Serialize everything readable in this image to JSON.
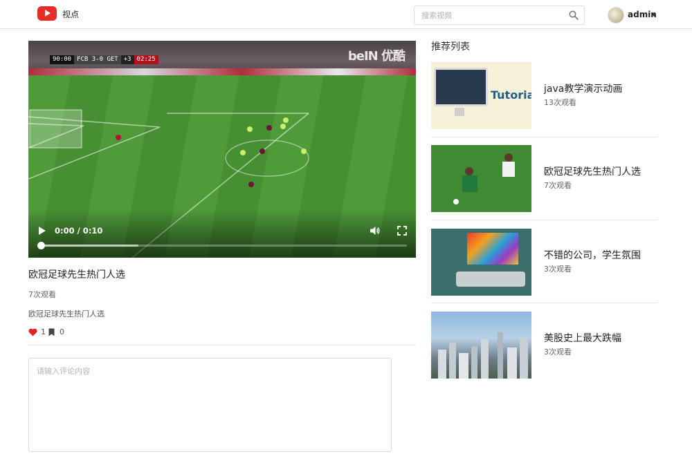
{
  "header": {
    "brand": "视点",
    "search_placeholder": "搜索视频",
    "username": "admin"
  },
  "video": {
    "scoreboard": {
      "time": "90:00",
      "score": "FCB 3-0 GET",
      "plus": "+3",
      "clock": "02:25"
    },
    "channel_logo": "beIN 优酷",
    "time_display": "0:00 / 0:10",
    "progress_buffered": 0.27,
    "title": "欧冠足球先生热门人选",
    "views": "7次观看",
    "description": "欧冠足球先生热门人选",
    "likes": "1",
    "favorites": "0"
  },
  "comment": {
    "placeholder": "请输入评论内容"
  },
  "sidebar": {
    "title": "推荐列表",
    "items": [
      {
        "title": "java教学演示动画",
        "views": "13次观看",
        "thumb_text": "Tutoria"
      },
      {
        "title": "欧冠足球先生热门人选",
        "views": "7次观看"
      },
      {
        "title": "不错的公司，学生氛围",
        "views": "3次观看"
      },
      {
        "title": "美股史上最大跌幅",
        "views": "3次观看"
      }
    ]
  },
  "colors": {
    "brand_red": "#e52d27",
    "heart": "#e02424"
  },
  "icons": [
    "play-icon",
    "search-icon",
    "volume-icon",
    "fullscreen-icon",
    "heart-icon",
    "bookmark-icon",
    "caret-down-icon"
  ]
}
